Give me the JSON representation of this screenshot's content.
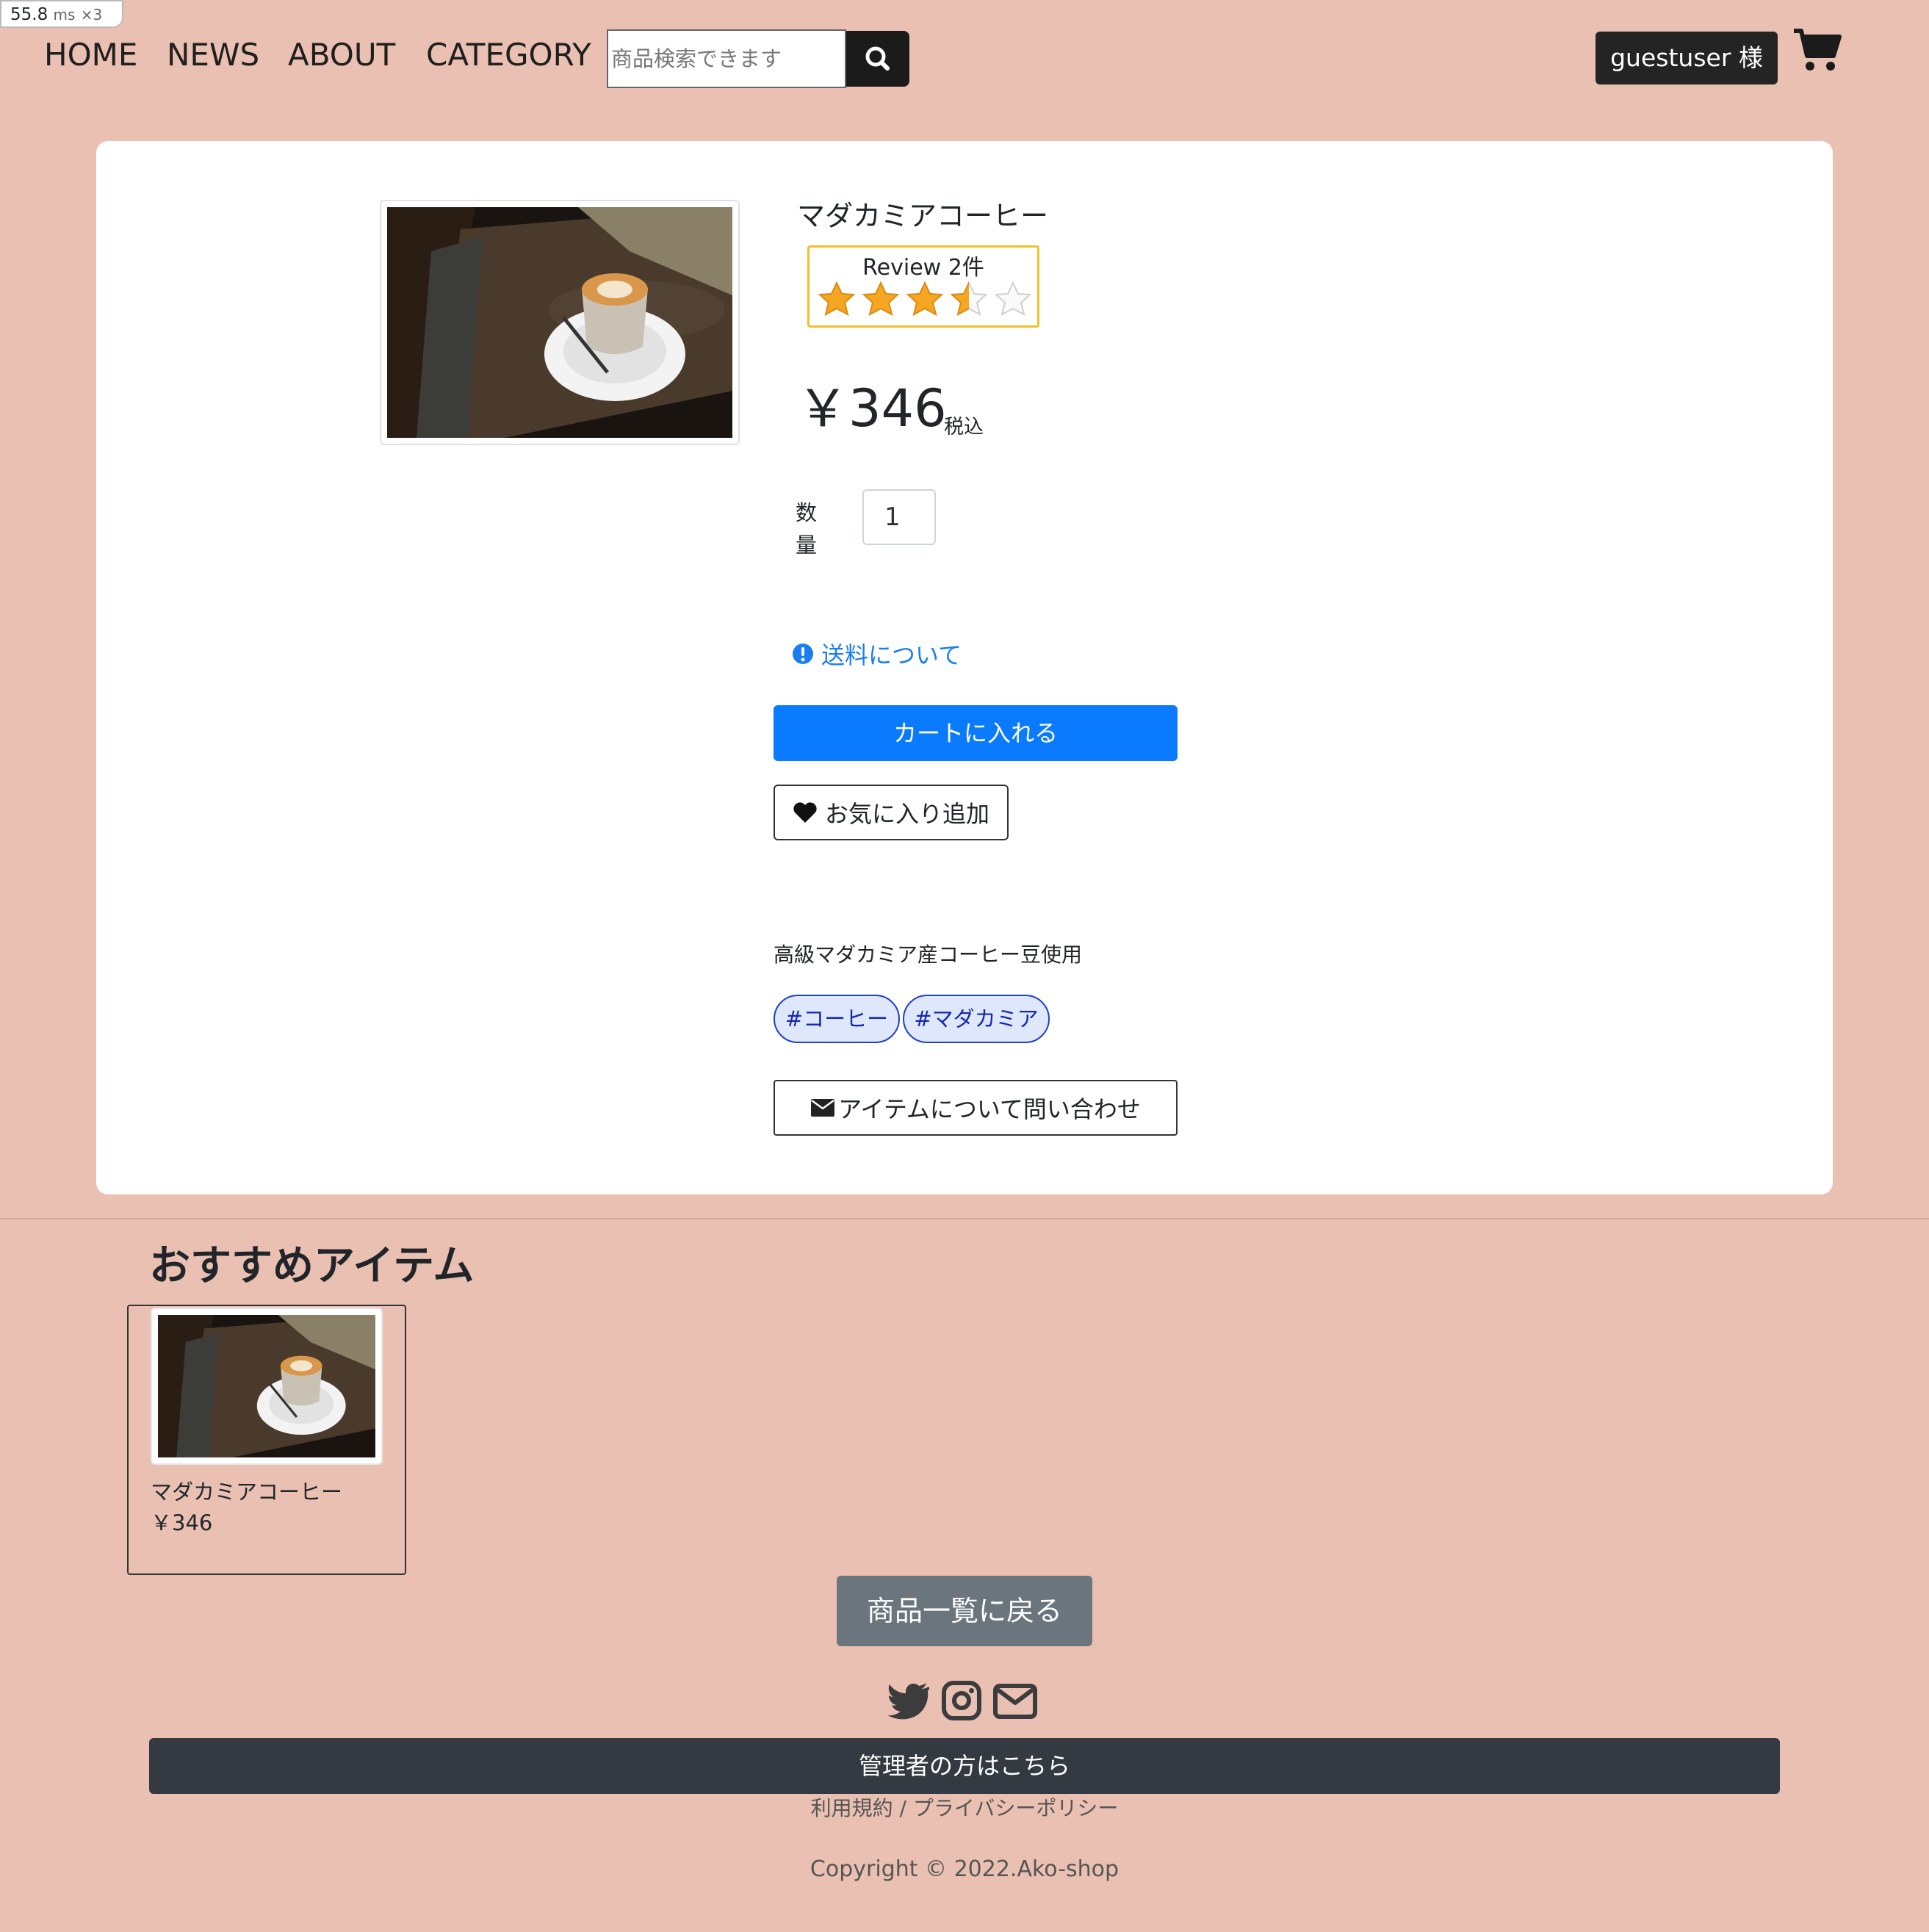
{
  "perf": {
    "value": "55.8",
    "unit": "ms",
    "multiplier": "×3"
  },
  "nav": {
    "links": [
      "HOME",
      "NEWS",
      "ABOUT",
      "CATEGORY"
    ],
    "search_placeholder": "商品検索できます",
    "user_label": "guestuser 様"
  },
  "product": {
    "name": "マダカミアコーヒー",
    "review_label": "Review 2件",
    "rating": 3.5,
    "rating_max": 5,
    "price": "￥346",
    "tax_label": "税込",
    "quantity_label": "数量",
    "quantity_value": "1",
    "shipping_link": "送料について",
    "add_to_cart": "カートに入れる",
    "favorite": "お気に入り追加",
    "description": "高級マダカミア産コーヒー豆使用",
    "tags": [
      "#コーヒー",
      "#マダカミア"
    ],
    "contact": "アイテムについて問い合わせ"
  },
  "recommendations": {
    "heading": "おすすめアイテム",
    "items": [
      {
        "name": "マダカミアコーヒー",
        "price": "￥346"
      }
    ]
  },
  "back_button": "商品一覧に戻る",
  "footer": {
    "admin_link": "管理者の方はこちら",
    "terms": "利用規約 / プライバシーポリシー",
    "copyright": "Copyright © 2022.Ako-shop",
    "social_icons": [
      "twitter-icon",
      "instagram-icon",
      "mail-icon"
    ]
  },
  "colors": {
    "page_background": "#e9c0b1",
    "primary": "#0a7aff",
    "dark": "#343a41",
    "secondary": "#6b757e",
    "star": "#f5a623",
    "tag_border": "#1e3fcf"
  }
}
